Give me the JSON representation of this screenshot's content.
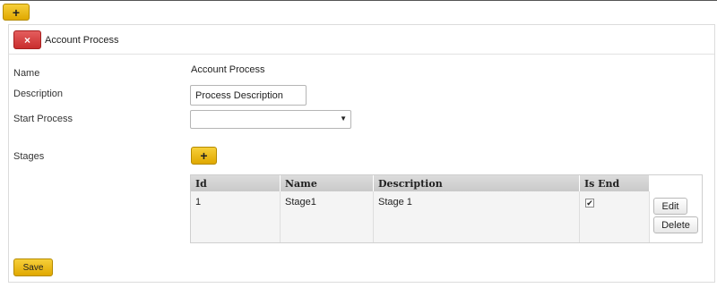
{
  "toolbar": {
    "add_icon": "plus-icon",
    "add_glyph": "+"
  },
  "panel": {
    "title": "Account Process",
    "remove_glyph": "×"
  },
  "form": {
    "name_label": "Name",
    "name_value": "Account Process",
    "description_label": "Description",
    "description_value": "Process Description",
    "start_process_label": "Start Process",
    "start_process_value": "",
    "start_process_arrow": "▼",
    "stages_label": "Stages",
    "stages_add_glyph": "+"
  },
  "grid": {
    "columns": [
      "Id",
      "Name",
      "Description",
      "Is End"
    ],
    "rows": [
      {
        "id": "1",
        "name": "Stage1",
        "description": "Stage 1",
        "is_end": "✔"
      }
    ],
    "edit_label": "Edit",
    "delete_label": "Delete"
  },
  "footer": {
    "save_label": "Save"
  },
  "colors": {
    "accent_yellow": "#e8b80f",
    "danger_red": "#d23c3c",
    "grid_header": "#d0d0d0"
  }
}
